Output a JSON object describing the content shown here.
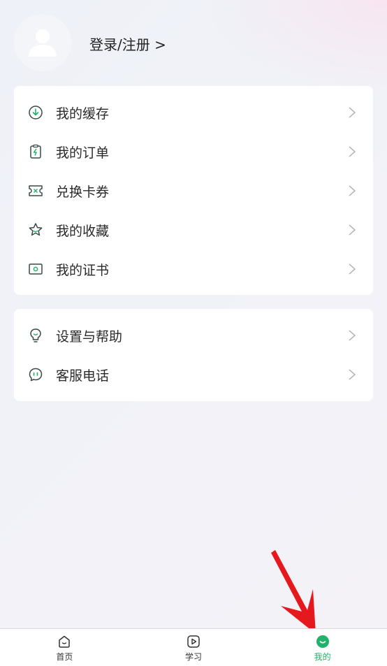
{
  "profile": {
    "avatar_icon": "user-avatar-icon",
    "login_label": "登录/注册 >"
  },
  "menu_group_1": [
    {
      "label": "我的缓存",
      "icon": "download-icon"
    },
    {
      "label": "我的订单",
      "icon": "order-clipboard-icon"
    },
    {
      "label": "兑换卡券",
      "icon": "coupon-ticket-icon"
    },
    {
      "label": "我的收藏",
      "icon": "star-icon"
    },
    {
      "label": "我的证书",
      "icon": "certificate-icon"
    }
  ],
  "menu_group_2": [
    {
      "label": "设置与帮助",
      "icon": "bulb-help-icon"
    },
    {
      "label": "客服电话",
      "icon": "chat-bubble-icon"
    }
  ],
  "tabbar": {
    "tabs": [
      {
        "label": "首页",
        "icon": "home-icon",
        "active": false
      },
      {
        "label": "学习",
        "icon": "play-icon",
        "active": false
      },
      {
        "label": "我的",
        "icon": "smile-icon",
        "active": true
      }
    ]
  },
  "colors": {
    "accent": "#21b36b",
    "annotation_arrow": "#e5181d",
    "icon_stroke": "#3a4a44"
  }
}
